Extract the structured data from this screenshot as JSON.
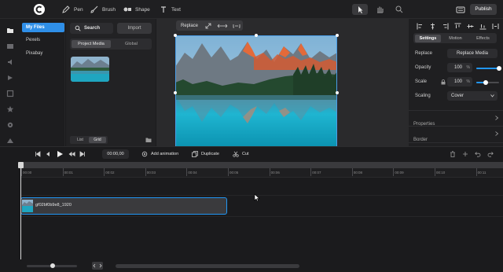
{
  "topbar": {
    "tools": [
      {
        "label": "Pen",
        "icon": "pen-icon"
      },
      {
        "label": "Brush",
        "icon": "brush-icon"
      },
      {
        "label": "Shape",
        "icon": "shape-icon"
      },
      {
        "label": "Text",
        "icon": "text-icon"
      }
    ],
    "publish_label": "Publish"
  },
  "files": {
    "items": [
      "My Files",
      "Pexels",
      "Pixabay"
    ],
    "active_index": 0
  },
  "media": {
    "search_label": "Search",
    "import_label": "Import",
    "tabs": [
      "Project Media",
      "Global"
    ],
    "view_list": "List",
    "view_grid": "Grid"
  },
  "canvas_toolbar": {
    "replace_label": "Replace"
  },
  "properties": {
    "tabs": [
      "Settings",
      "Motion",
      "Effects"
    ],
    "replace_label": "Replace",
    "replace_button": "Replace Media",
    "opacity_label": "Opacity",
    "opacity_value": "100",
    "opacity_unit": "%",
    "opacity_fraction": 1.0,
    "scale_label": "Scale",
    "scale_value": "100",
    "scale_unit": "%",
    "scale_fraction": 0.4,
    "scaling_label": "Scaling",
    "scaling_value": "Cover",
    "sections": [
      "Properties",
      "Border"
    ]
  },
  "timeline": {
    "timecode": "00:00,00",
    "add_animation_label": "Add animation",
    "duplicate_label": "Duplicate",
    "cut_label": "Cut",
    "ticks": [
      "00:00",
      "00:01",
      "00:02",
      "00:03",
      "00:04",
      "00:05",
      "00:06",
      "00:07",
      "00:08",
      "00:09",
      "00:10",
      "00:11"
    ],
    "clip_name": "gf02bf0b9e8_1920"
  },
  "colors": {
    "accent": "#2196f3",
    "publish_bg": "#3a3a3d"
  }
}
